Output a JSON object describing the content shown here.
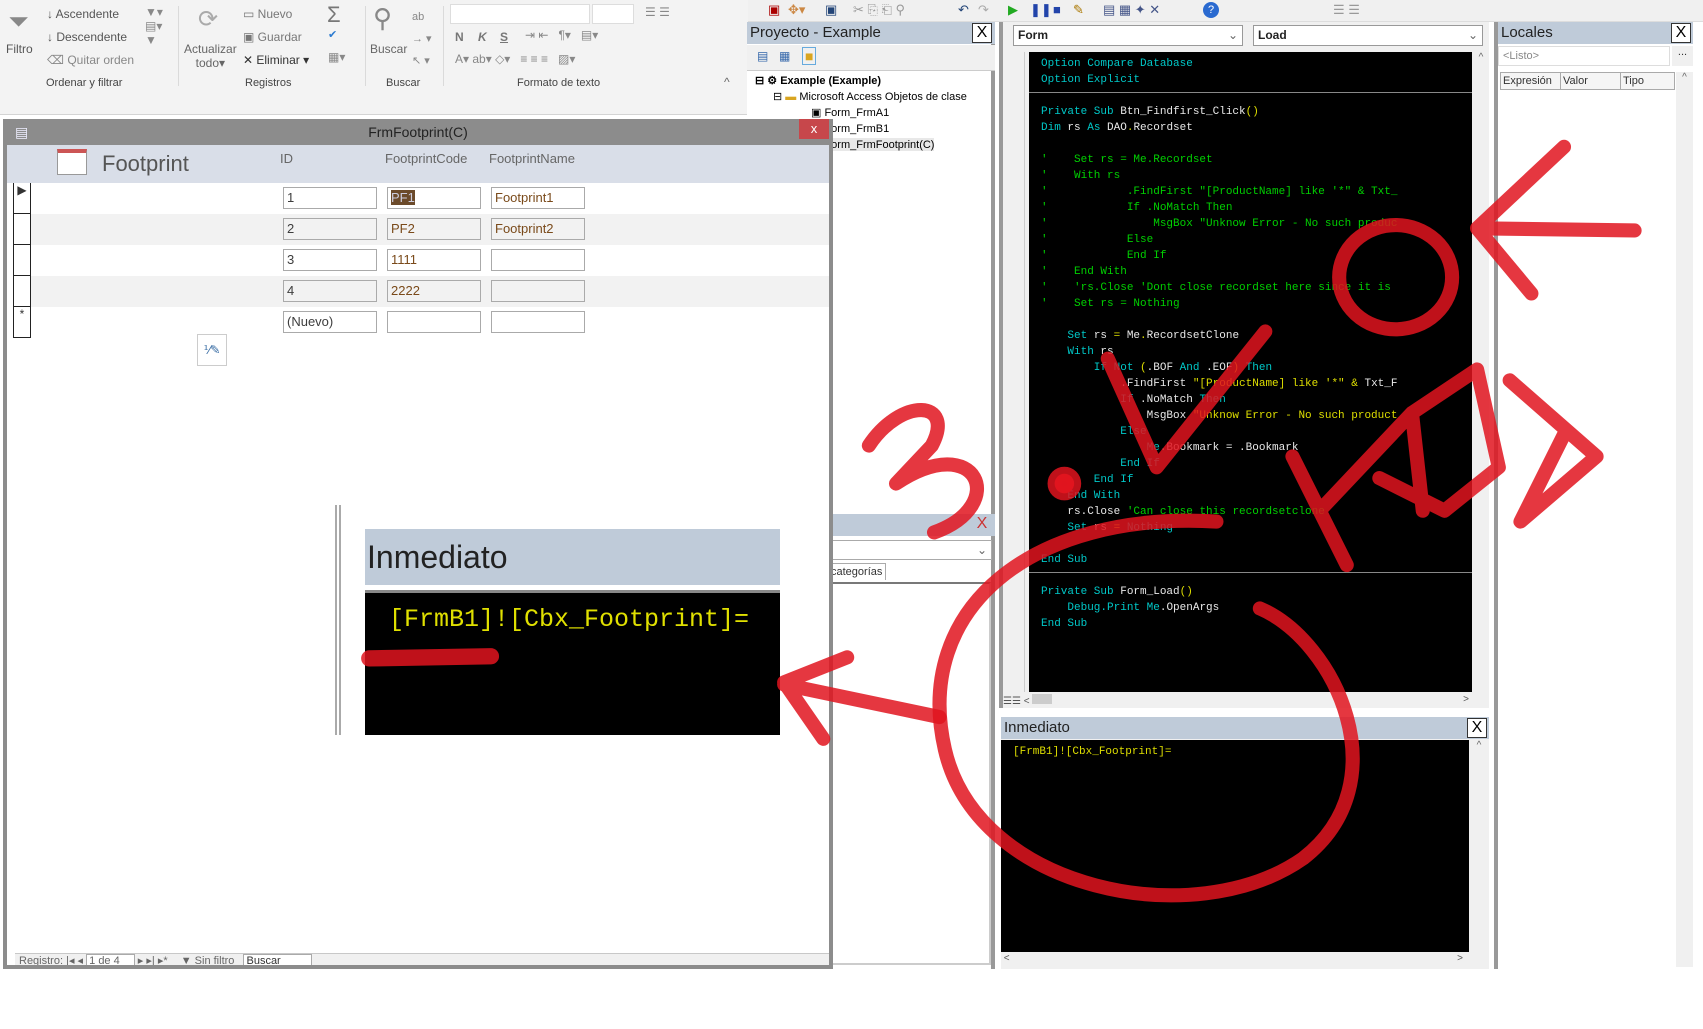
{
  "ribbon": {
    "filtro": "Filtro",
    "ascendente": "Ascendente",
    "descendente": "Descendente",
    "quitar_orden": "Quitar orden",
    "actualizar": "Actualizar",
    "todo": "todo",
    "nuevo": "Nuevo",
    "guardar": "Guardar",
    "eliminar": "Eliminar",
    "buscar": "Buscar",
    "bold": "N",
    "italic": "K",
    "underline": "S",
    "groups": [
      "Ordenar y filtrar",
      "Registros",
      "Buscar",
      "Formato de texto"
    ]
  },
  "form": {
    "title": "FrmFootprint(C)",
    "close": "x",
    "header_title": "Footprint",
    "columns": [
      "ID",
      "FootprintCode",
      "FootprintName"
    ],
    "rows": [
      [
        "1",
        "PF1",
        "Footprint1"
      ],
      [
        "2",
        "PF2",
        "Footprint2"
      ],
      [
        "3",
        "1111",
        ""
      ],
      [
        "4",
        "2222",
        ""
      ],
      [
        "(Nuevo)",
        "",
        ""
      ]
    ],
    "status": {
      "label": "Registro:",
      "position": "1 de 4",
      "filter": "Sin filtro",
      "search": "Buscar"
    }
  },
  "inset": {
    "title": "Inmediato",
    "content": "[FrmB1]![Cbx_Footprint]="
  },
  "project": {
    "title": "Proyecto - Example",
    "close": "X",
    "tree": [
      "Example (Example)",
      "Microsoft Access Objetos de clase",
      "Form_FrmA1",
      "Form_FrmB1",
      "Form_FrmFootprint(C)"
    ]
  },
  "properties": {
    "tab": "categorías",
    "close": "X"
  },
  "code": {
    "object_combo": "Form",
    "proc_combo": "Load",
    "lines": [
      [
        [
          "Option Compare Database",
          "k"
        ]
      ],
      [
        [
          "Option Explicit",
          "k"
        ]
      ],
      [],
      [
        [
          "Private Sub ",
          "k"
        ],
        [
          "Btn_Findfirst_Click",
          "t"
        ],
        [
          "()",
          "s"
        ]
      ],
      [
        [
          "Dim ",
          "k"
        ],
        [
          "rs ",
          "t"
        ],
        [
          "As ",
          "k"
        ],
        [
          "DAO",
          "t"
        ],
        [
          ".",
          "s"
        ],
        [
          "Recordset",
          "t"
        ]
      ],
      [],
      [
        [
          "'    Set rs = Me.Recordset",
          "c"
        ]
      ],
      [
        [
          "'    With rs",
          "c"
        ]
      ],
      [
        [
          "'            .FindFirst \"[ProductName] like '*\" & Txt_",
          "c"
        ]
      ],
      [
        [
          "'            If .NoMatch Then",
          "c"
        ]
      ],
      [
        [
          "'                MsgBox \"Unknow Error - No such produc",
          "c"
        ]
      ],
      [
        [
          "'            Else",
          "c"
        ]
      ],
      [
        [
          "'            End If",
          "c"
        ]
      ],
      [
        [
          "'    End With",
          "c"
        ]
      ],
      [
        [
          "'    'rs.Close 'Dont close recordset here since it is",
          "c"
        ]
      ],
      [
        [
          "'    Set rs = Nothing",
          "c"
        ]
      ],
      [],
      [
        [
          "    Set ",
          "k"
        ],
        [
          "rs ",
          "t"
        ],
        [
          "= ",
          "s"
        ],
        [
          "Me",
          "t"
        ],
        [
          ".",
          "s"
        ],
        [
          "RecordsetClone",
          "t"
        ]
      ],
      [
        [
          "    With ",
          "k"
        ],
        [
          "rs",
          "t"
        ]
      ],
      [
        [
          "        If Not ",
          "k"
        ],
        [
          "(",
          "s"
        ],
        [
          ".BOF ",
          "t"
        ],
        [
          "And ",
          "k"
        ],
        [
          ".EOF",
          "t"
        ],
        [
          ") ",
          "s"
        ],
        [
          "Then",
          "k"
        ]
      ],
      [
        [
          "            .FindFirst ",
          "t"
        ],
        [
          "\"[ProductName] like '*\" ",
          "s"
        ],
        [
          "& ",
          "s"
        ],
        [
          "Txt_F",
          "t"
        ]
      ],
      [
        [
          "            If ",
          "k"
        ],
        [
          ".NoMatch ",
          "t"
        ],
        [
          "Then",
          "k"
        ]
      ],
      [
        [
          "                MsgBox ",
          "t"
        ],
        [
          "\"Unknow Error - No such product",
          "s"
        ]
      ],
      [
        [
          "            Else",
          "k"
        ]
      ],
      [
        [
          "                Me",
          "k"
        ],
        [
          ".Bookmark = .Bookmark",
          "t"
        ]
      ],
      [
        [
          "            End If",
          "k"
        ]
      ],
      [
        [
          "        End If",
          "k"
        ]
      ],
      [
        [
          "    End With",
          "k"
        ]
      ],
      [
        [
          "    rs",
          "t"
        ],
        [
          ".Close ",
          "t"
        ],
        [
          "'Can close this recordsetclone",
          "c"
        ]
      ],
      [
        [
          "    Set ",
          "k"
        ],
        [
          "rs ",
          "t"
        ],
        [
          "= ",
          "s"
        ],
        [
          "Nothing",
          "k"
        ]
      ],
      [],
      [
        [
          "End Sub",
          "k"
        ]
      ],
      [],
      [
        [
          "Private Sub ",
          "k"
        ],
        [
          "Form_Load",
          "t"
        ],
        [
          "()",
          "s"
        ]
      ],
      [
        [
          "    Debug",
          "k"
        ],
        [
          ".Print ",
          "k"
        ],
        [
          "Me",
          "k"
        ],
        [
          ".OpenArgs",
          "t"
        ]
      ],
      [
        [
          "End Sub",
          "k"
        ]
      ]
    ]
  },
  "immediate": {
    "title": "Inmediato",
    "close": "X",
    "content": "[FrmB1]![Cbx_Footprint]="
  },
  "locals": {
    "title": "Locales",
    "close": "X",
    "status": "<Listo>",
    "more": "...",
    "columns": [
      "Expresión",
      "Valor",
      "Tipo"
    ]
  },
  "colors": {
    "annotation": "#e0141e",
    "code_bg": "#000000",
    "pane_title": "#bfcbd9",
    "close_red": "#c7474b"
  }
}
